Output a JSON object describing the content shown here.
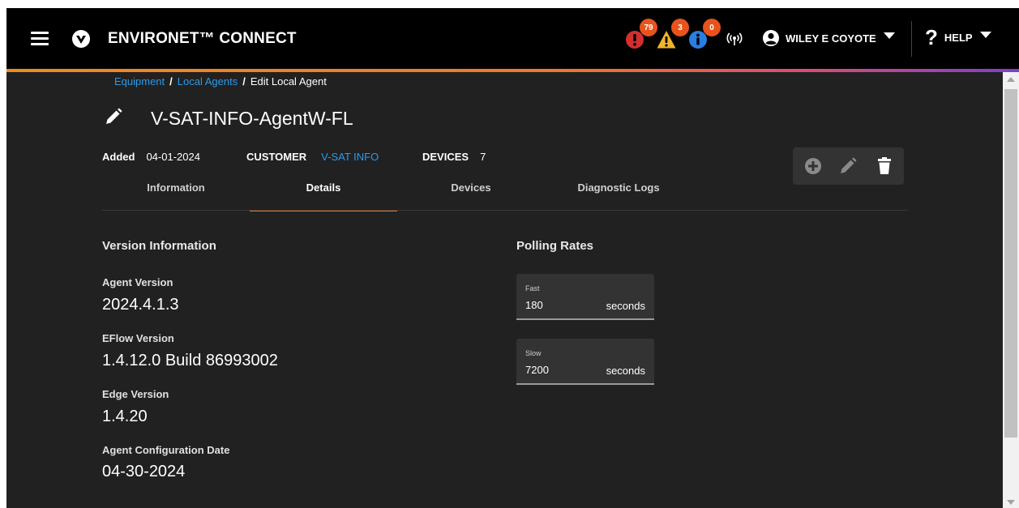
{
  "header": {
    "app_title": "ENVIRONET™ CONNECT",
    "alerts": [
      {
        "name": "critical",
        "count": "79",
        "color": "#d32f2f",
        "icon": "exclamation-circle-icon"
      },
      {
        "name": "warning",
        "count": "3",
        "color": "#f0b429",
        "icon": "warning-triangle-icon"
      },
      {
        "name": "info",
        "count": "0",
        "color": "#2a7de1",
        "icon": "info-circle-icon"
      }
    ],
    "badge_color": "#e8531c",
    "user_name": "WILEY E COYOTE",
    "help_label": "HELP"
  },
  "breadcrumb": [
    {
      "label": "Equipment"
    },
    {
      "label": "Local Agents"
    },
    {
      "label": "Edit Local Agent"
    }
  ],
  "breadcrumb_sep": "/",
  "agent": {
    "title": "V-SAT-INFO-AgentW-FL",
    "added_label": "Added",
    "added_value": "04-01-2024",
    "customer_label": "CUSTOMER",
    "customer_value": "V-SAT INFO",
    "devices_label": "DEVICES",
    "devices_value": "7"
  },
  "tabs": [
    {
      "label": "Information",
      "active": false
    },
    {
      "label": "Details",
      "active": true
    },
    {
      "label": "Devices",
      "active": false
    },
    {
      "label": "Diagnostic Logs",
      "active": false
    }
  ],
  "version_info": {
    "heading": "Version Information",
    "fields": [
      {
        "label": "Agent Version",
        "value": "2024.4.1.3"
      },
      {
        "label": "EFlow Version",
        "value": "1.4.12.0 Build 86993002"
      },
      {
        "label": "Edge Version",
        "value": "1.4.20"
      },
      {
        "label": "Agent Configuration Date",
        "value": "04-30-2024"
      }
    ]
  },
  "polling": {
    "heading": "Polling Rates",
    "rates": [
      {
        "label": "Fast",
        "value": "180",
        "unit": "seconds"
      },
      {
        "label": "Slow",
        "value": "7200",
        "unit": "seconds"
      }
    ]
  },
  "colors": {
    "link": "#2a9bea",
    "accent": "#f0772a",
    "background": "#212121"
  }
}
